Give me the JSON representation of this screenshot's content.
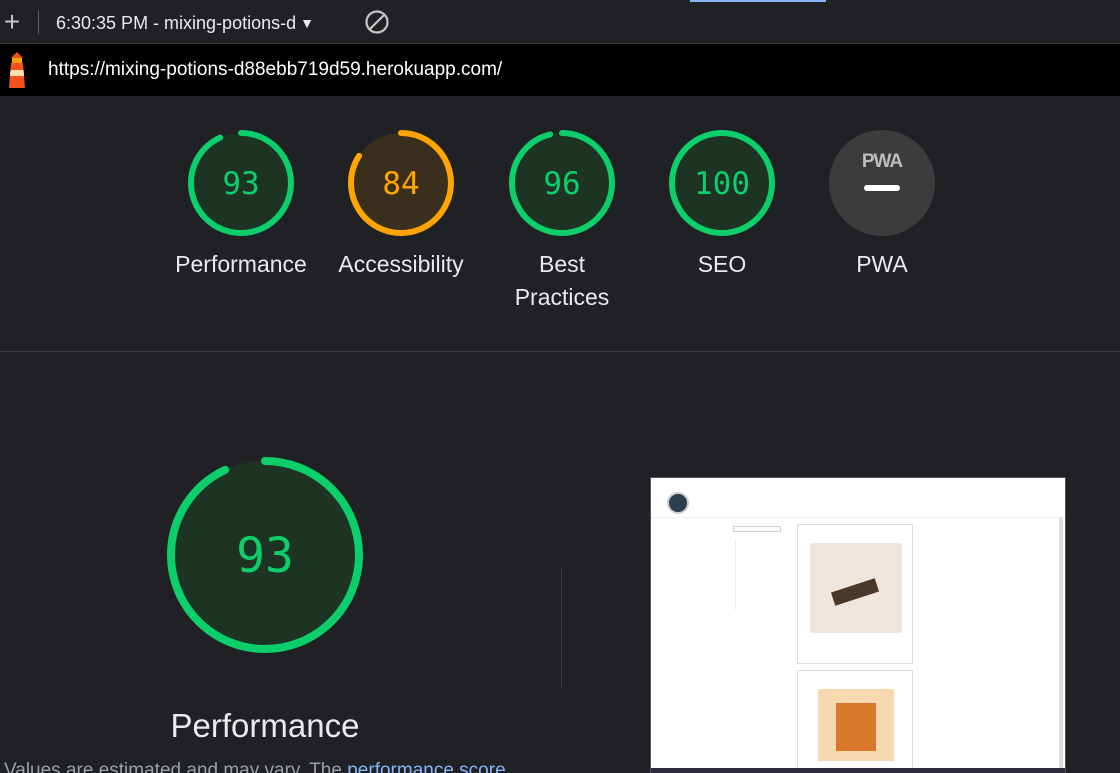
{
  "toolbar": {
    "add_label": "+",
    "report_label": "6:30:35 PM - mixing-potions-d"
  },
  "urlbar": {
    "url": "https://mixing-potions-d88ebb719d59.herokuapp.com/"
  },
  "categories": [
    {
      "label": "Performance",
      "score": "93",
      "score_value": 93,
      "status": "pass"
    },
    {
      "label": "Accessibility",
      "score": "84",
      "score_value": 84,
      "status": "average"
    },
    {
      "label": "Best Practices",
      "score": "96",
      "score_value": 96,
      "status": "pass"
    },
    {
      "label": "SEO",
      "score": "100",
      "score_value": 100,
      "status": "pass"
    },
    {
      "label": "PWA",
      "badge": "PWA",
      "score": "—",
      "status": "na"
    }
  ],
  "performance": {
    "score": "93",
    "score_value": 93,
    "title": "Performance",
    "note_prefix": "Values are estimated and may vary. The ",
    "note_link": "performance score"
  },
  "colors": {
    "pass": "#0cce6b",
    "average": "#ffa400",
    "na": "#3c3c3c"
  }
}
